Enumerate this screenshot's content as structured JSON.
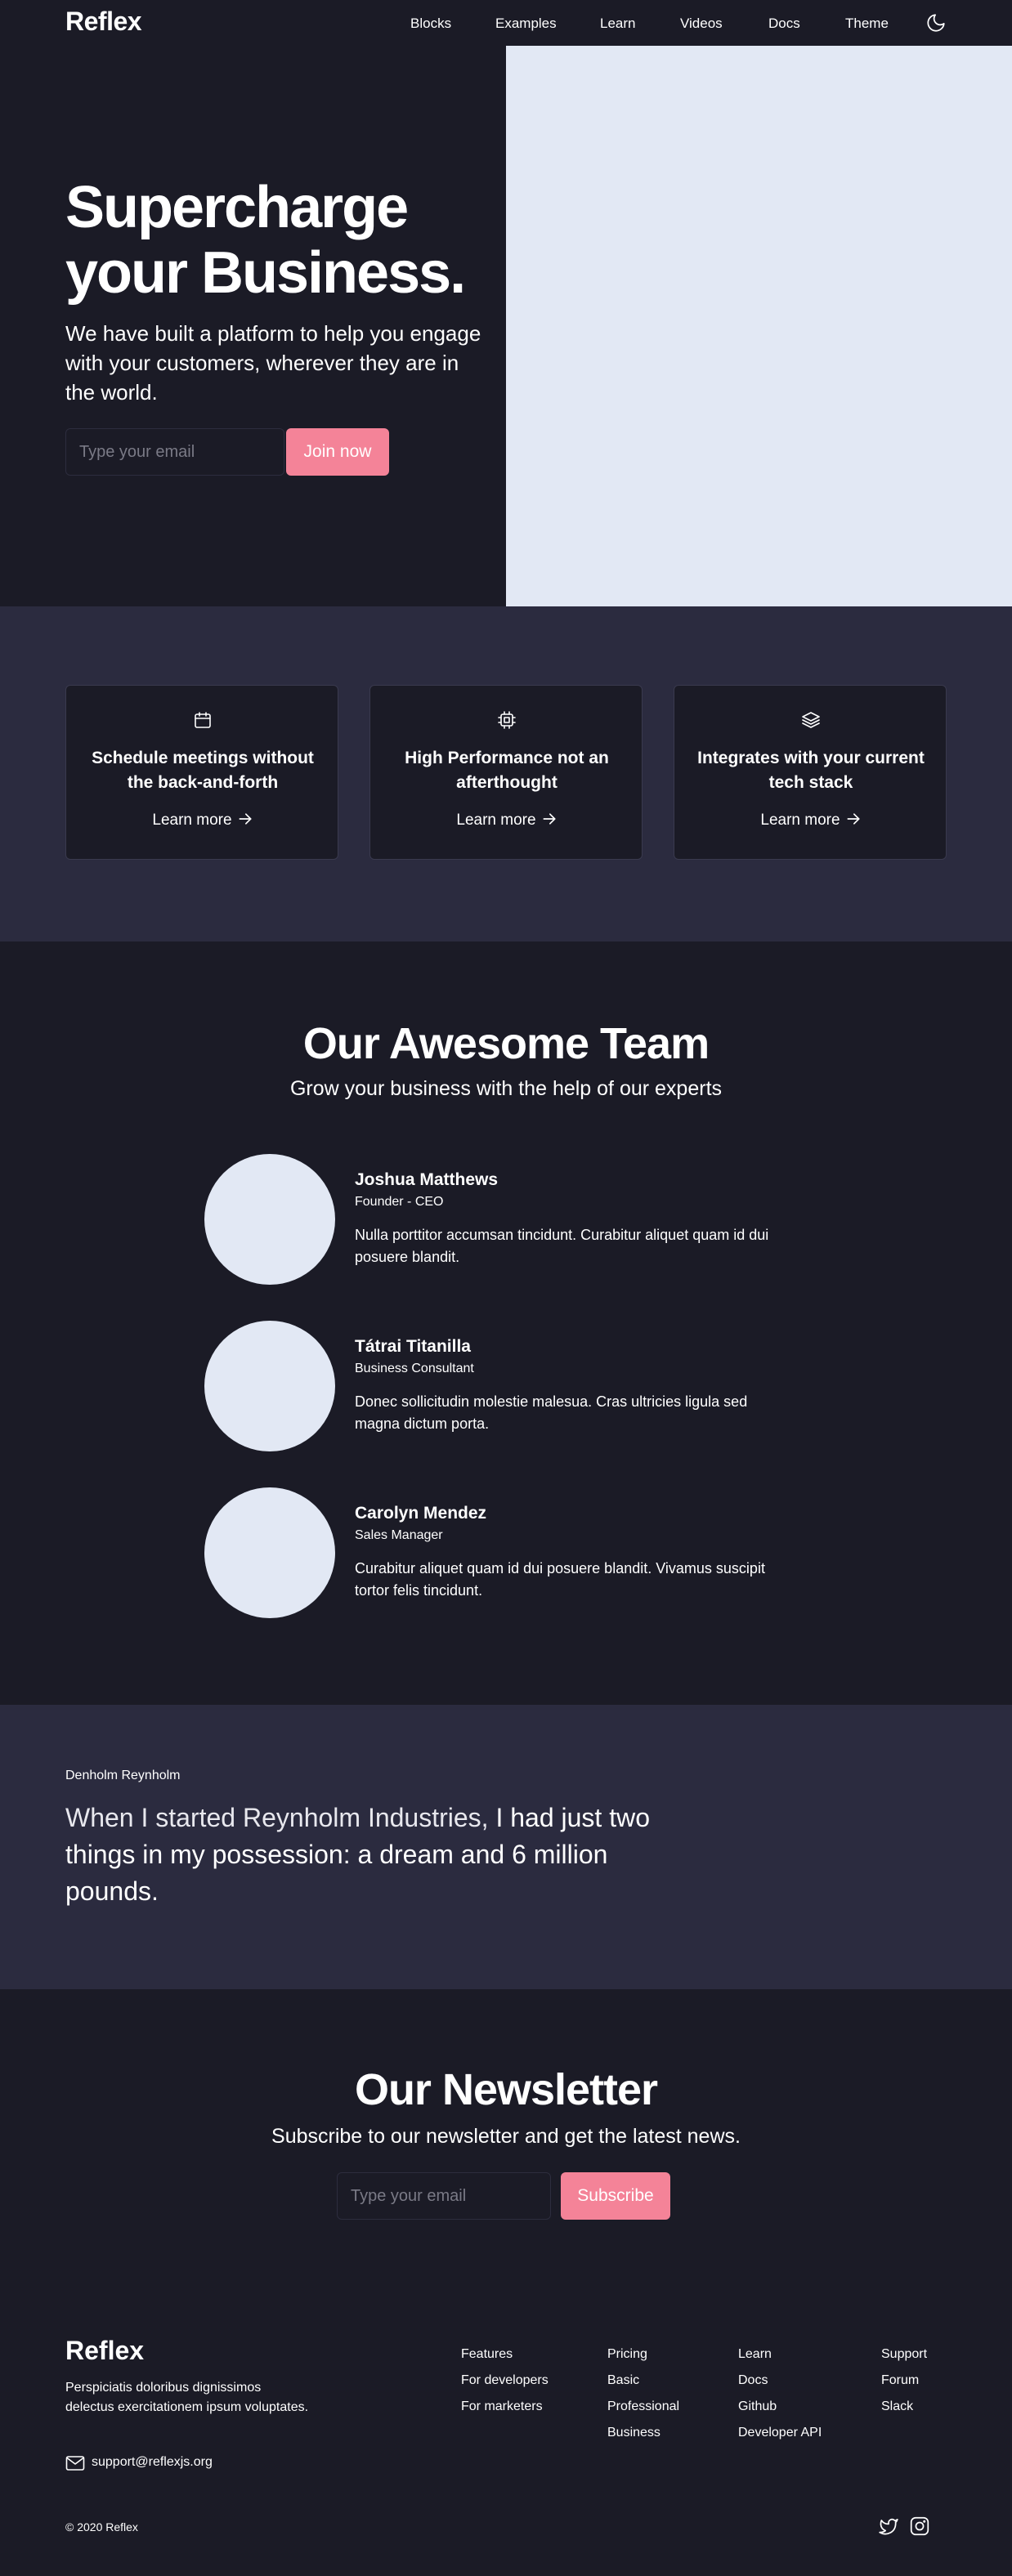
{
  "nav": {
    "logo": "Reflex",
    "links": [
      "Blocks",
      "Examples",
      "Learn",
      "Videos",
      "Docs",
      "Theme"
    ],
    "theme_toggle_icon": "moon-icon"
  },
  "hero": {
    "title": "Supercharge your Business.",
    "subtitle": "We have built a platform to help you engage with your customers, wherever they are in the world.",
    "email_placeholder": "Type your email",
    "cta_label": "Join now"
  },
  "features": [
    {
      "icon": "calendar-icon",
      "title": "Schedule meetings without the back-and-forth",
      "link": "Learn more"
    },
    {
      "icon": "cpu-icon",
      "title": "High Performance not an afterthought",
      "link": "Learn more"
    },
    {
      "icon": "layers-icon",
      "title": "Integrates with your current tech stack",
      "link": "Learn more"
    }
  ],
  "team": {
    "title": "Our Awesome Team",
    "subtitle": "Grow your business with the help of our experts",
    "members": [
      {
        "name": "Joshua Matthews",
        "role": "Founder - CEO",
        "bio": "Nulla porttitor accumsan tincidunt. Curabitur aliquet quam id dui posuere blandit."
      },
      {
        "name": "Tátrai Titanilla",
        "role": "Business Consultant",
        "bio": "Donec sollicitudin molestie malesua. Cras ultricies ligula sed magna dictum porta."
      },
      {
        "name": "Carolyn Mendez",
        "role": "Sales Manager",
        "bio": "Curabitur aliquet quam id dui posuere blandit. Vivamus suscipit tortor felis tincidunt."
      }
    ]
  },
  "quote": {
    "author": "Denholm Reynholm",
    "text_light": "When I started Reynholm Industries,",
    "text_bold": "I had just two things in my possession: a dream and 6 million pounds."
  },
  "newsletter": {
    "title": "Our Newsletter",
    "subtitle": "Subscribe to our newsletter and get the latest news.",
    "email_placeholder": "Type your email",
    "cta_label": "Subscribe"
  },
  "footer": {
    "logo": "Reflex",
    "description": "Perspiciatis doloribus dignissimos delectus exercitationem ipsum voluptates.",
    "email": "support@reflexjs.org",
    "columns": [
      {
        "title": "Features",
        "items": [
          "For developers",
          "For marketers"
        ]
      },
      {
        "title": "Pricing",
        "items": [
          "Basic",
          "Professional",
          "Business"
        ]
      },
      {
        "title": "Learn",
        "items": [
          "Docs",
          "Github",
          "Developer API"
        ]
      },
      {
        "title": "Support",
        "items": [
          "Forum",
          "Slack"
        ]
      }
    ],
    "copyright": "© 2020 Reflex",
    "social_icons": [
      "twitter-icon",
      "instagram-icon"
    ]
  },
  "colors": {
    "background": "#1b1b26",
    "section_alt": "#2b2b3f",
    "accent": "#f48398",
    "placeholder_image": "#e2e8f4"
  }
}
